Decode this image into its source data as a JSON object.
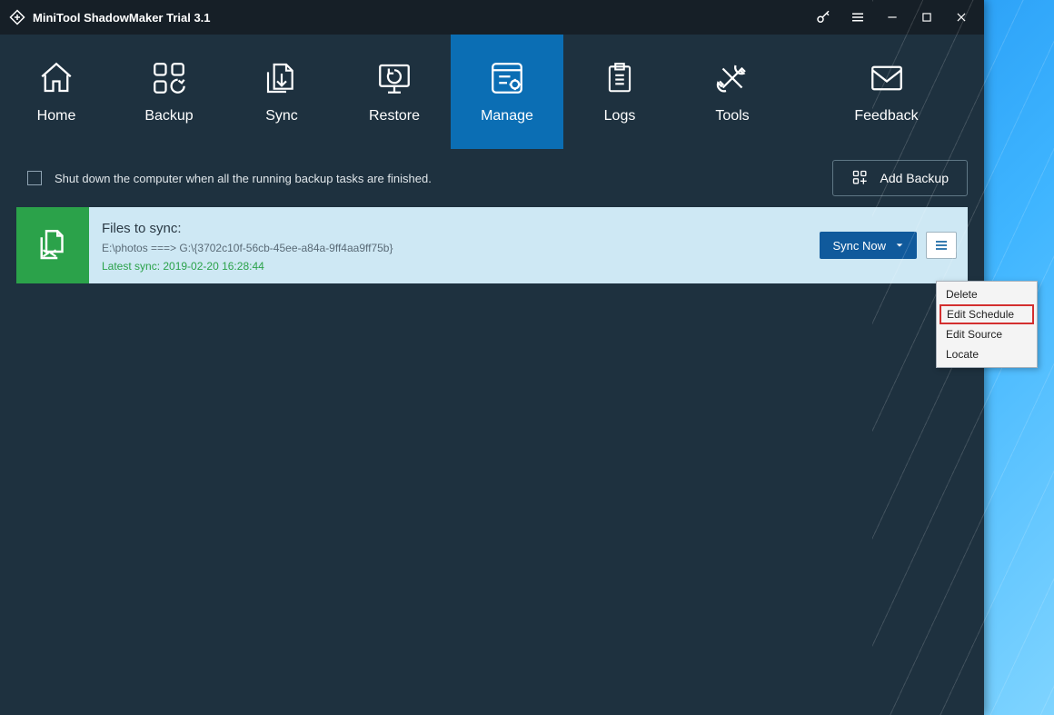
{
  "window": {
    "title": "MiniTool ShadowMaker Trial 3.1"
  },
  "nav": {
    "home": "Home",
    "backup": "Backup",
    "sync": "Sync",
    "restore": "Restore",
    "manage": "Manage",
    "logs": "Logs",
    "tools": "Tools",
    "feedback": "Feedback"
  },
  "options": {
    "shutdown_label": "Shut down the computer when all the running backup tasks are finished.",
    "add_backup": "Add Backup"
  },
  "task": {
    "title": "Files to sync:",
    "path": "E:\\photos ===> G:\\{3702c10f-56cb-45ee-a84a-9ff4aa9ff75b}",
    "status": "Latest sync: 2019-02-20 16:28:44",
    "sync_now": "Sync Now"
  },
  "context_menu": {
    "delete": "Delete",
    "edit_schedule": "Edit Schedule",
    "edit_source": "Edit Source",
    "locate": "Locate"
  }
}
